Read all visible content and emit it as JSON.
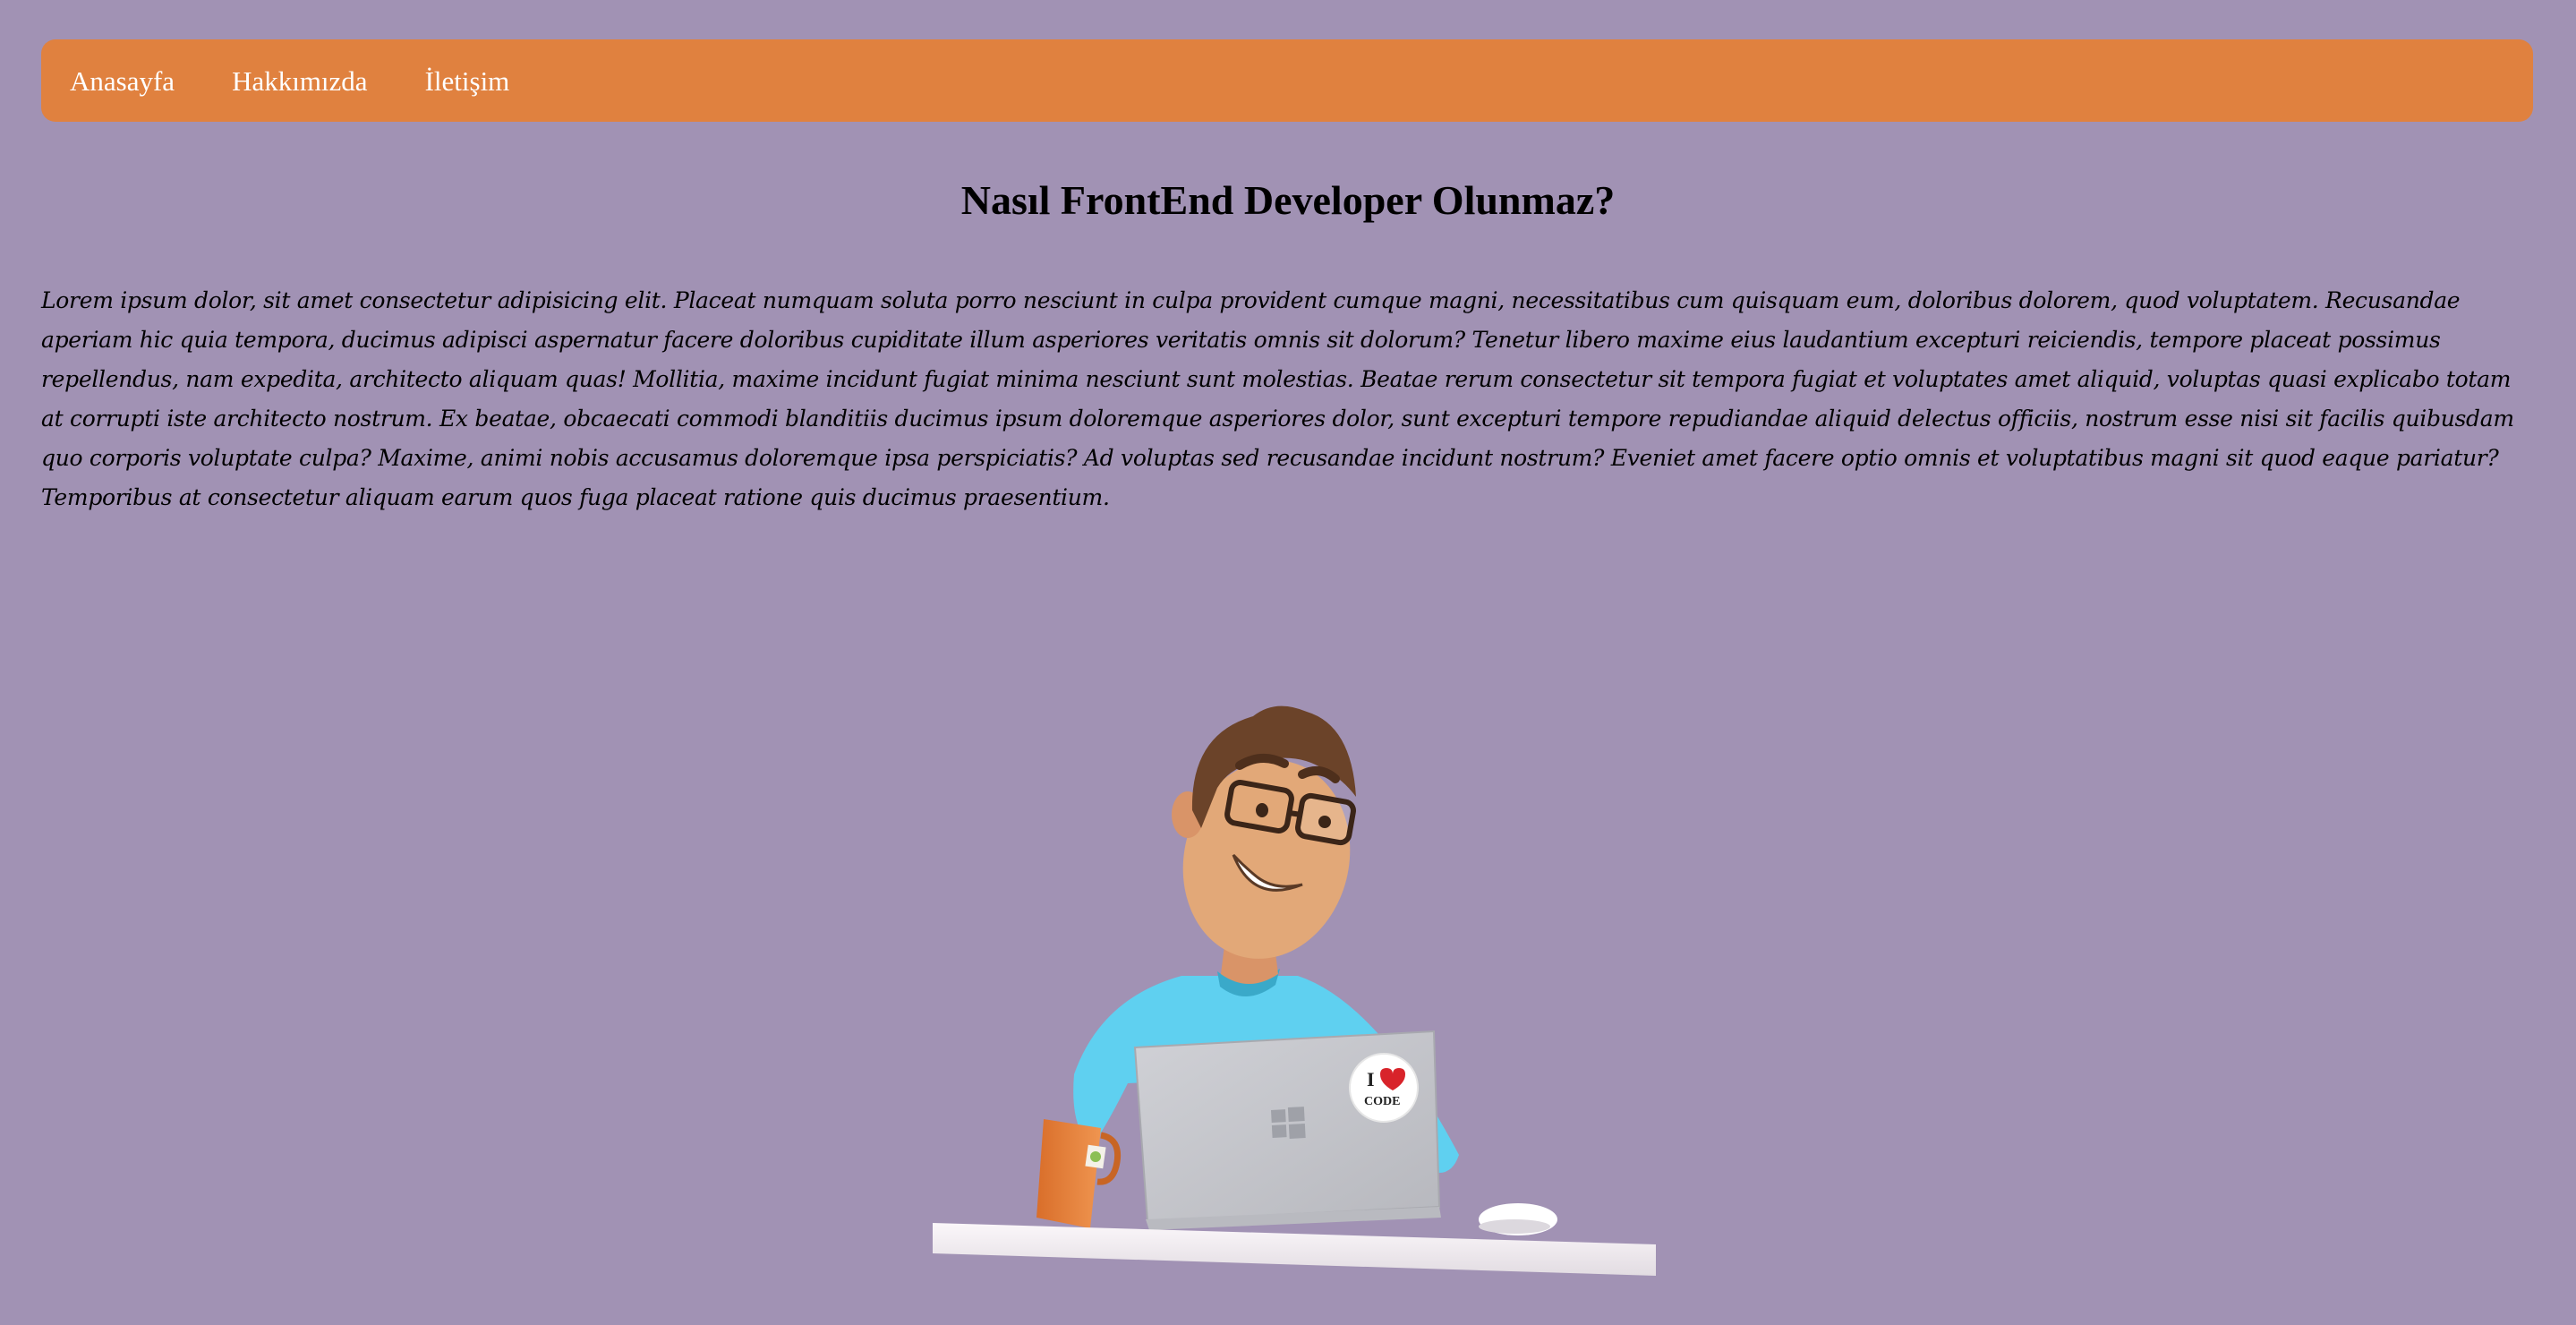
{
  "nav": {
    "items": [
      {
        "label": "Anasayfa"
      },
      {
        "label": "Hakkımızda"
      },
      {
        "label": "İletişim"
      }
    ]
  },
  "main": {
    "title": "Nasıl FrontEnd Developer Olunmaz?",
    "paragraph": "Lorem ipsum dolor, sit amet consectetur adipisicing elit. Placeat numquam soluta porro nesciunt in culpa provident cumque magni, necessitatibus cum quisquam eum, doloribus dolorem, quod voluptatem. Recusandae aperiam hic quia tempora, ducimus adipisci aspernatur facere doloribus cupiditate illum asperiores veritatis omnis sit dolorum? Tenetur libero maxime eius laudantium excepturi reiciendis, tempore placeat possimus repellendus, nam expedita, architecto aliquam quas! Mollitia, maxime incidunt fugiat minima nesciunt sunt molestias. Beatae rerum consectetur sit tempora fugiat et voluptates amet aliquid, voluptas quasi explicabo totam at corrupti iste architecto nostrum. Ex beatae, obcaecati commodi blanditiis ducimus ipsum doloremque asperiores dolor, sunt excepturi tempore repudiandae aliquid delectus officiis, nostrum esse nisi sit facilis quibusdam quo corporis voluptate culpa? Maxime, animi nobis accusamus doloremque ipsa perspiciatis? Ad voluptas sed recusandae incidunt nostrum? Eveniet amet facere optio omnis et voluptatibus magni sit quod eaque pariatur? Temporibus at consectetur aliquam earum quos fuga placeat ratione quis ducimus praesentium."
  },
  "illustration": {
    "sticker_text": "I ♥ CODE",
    "colors": {
      "background": "#a192b4",
      "navbar": "#e0813f",
      "shirt": "#5fd0f0",
      "laptop": "#c4c6cc",
      "skin": "#e2a878",
      "hair": "#6b4329",
      "mug": "#e07b35"
    }
  }
}
